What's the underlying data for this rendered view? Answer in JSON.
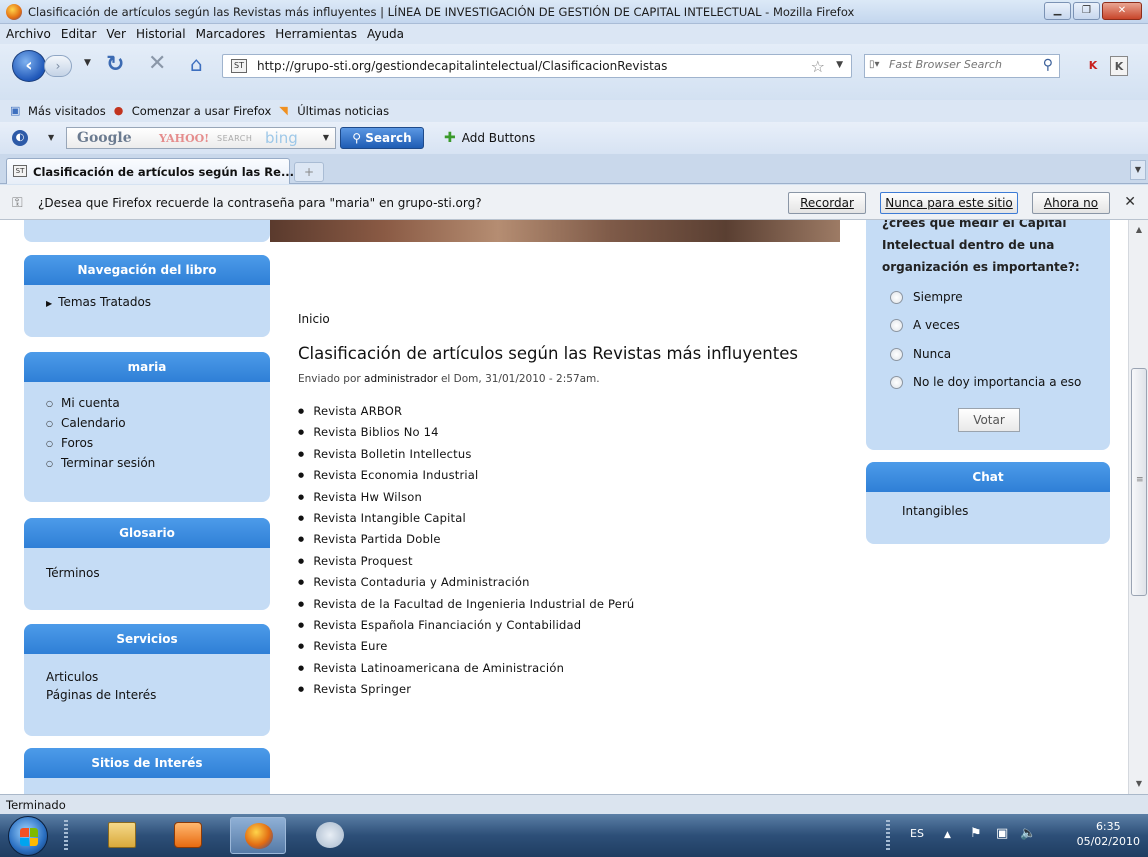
{
  "window": {
    "title": "Clasificación de artículos según las Revistas más influyentes | LÍNEA DE INVESTIGACIÓN DE GESTIÓN DE CAPITAL INTELECTUAL - Mozilla Firefox"
  },
  "menu": [
    "Archivo",
    "Editar",
    "Ver",
    "Historial",
    "Marcadores",
    "Herramientas",
    "Ayuda"
  ],
  "navbar": {
    "url": "http://grupo-sti.org/gestiondecapitalintelectual/ClasificacionRevistas",
    "search_placeholder": "Fast Browser Search"
  },
  "bookmarks": [
    {
      "label": "Más visitados",
      "icon": "bookmark-star-icon"
    },
    {
      "label": "Comenzar a usar Firefox",
      "icon": "firefox-icon"
    },
    {
      "label": "Últimas noticias",
      "icon": "rss-icon"
    }
  ],
  "search_toolbar": {
    "engine_google": "Google",
    "engine_yahoo": "YAHOO!",
    "engine_search": "SEARCH",
    "engine_bing": "bing",
    "search_label": "Search",
    "add_buttons_label": "Add Buttons"
  },
  "tab": {
    "label": "Clasificación de artículos según las Re...",
    "new_tab": "+"
  },
  "notification": {
    "message": "¿Desea que Firefox recuerde la contraseña para \"maria\" en grupo-sti.org?",
    "remember": "Recordar",
    "never": "Nunca para este sitio",
    "not_now": "Ahora no"
  },
  "sidebar": {
    "book_nav": {
      "title": "Navegación del libro",
      "item": "Temas Tratados"
    },
    "user": {
      "title": "maria",
      "items": [
        "Mi cuenta",
        "Calendario",
        "Foros",
        "Terminar sesión"
      ]
    },
    "glossary": {
      "title": "Glosario",
      "item": "Términos"
    },
    "services": {
      "title": "Servicios",
      "items": [
        "Articulos",
        "Páginas de Interés"
      ]
    },
    "sites": {
      "title": "Sitios de Interés"
    }
  },
  "main": {
    "breadcrumb": "Inicio",
    "title": "Clasificación de artículos según las Revistas más influyentes",
    "submitted_prefix": "Enviado por",
    "author": "administrador",
    "submitted_suffix": "el Dom, 31/01/2010 - 2:57am.",
    "magazines": [
      "Revista ARBOR",
      "Revista Biblios No 14",
      "Revista Bolletin Intellectus",
      "Revista Economia Industrial",
      "Revista Hw Wilson",
      "Revista Intangible Capital",
      "Revista Partida Doble",
      "Revista Proquest",
      "Revista Contaduria y Administración",
      "Revista de la Facultad de Ingenieria Industrial de Perú",
      "Revista Española Financiación y Contabilidad",
      "Revista Eure",
      "Revista Latinoamericana de Aministración",
      "Revista Springer"
    ]
  },
  "poll": {
    "question": "¿crees que medir el Capital Intelectual dentro de una organización es importante?:",
    "options": [
      "Siempre",
      "A veces",
      "Nunca",
      "No le doy importancia a eso"
    ],
    "vote": "Votar"
  },
  "chat": {
    "title": "Chat",
    "item": "Intangibles"
  },
  "status": {
    "text": "Terminado"
  },
  "taskbar": {
    "lang": "ES",
    "time": "6:35",
    "date": "05/02/2010"
  }
}
